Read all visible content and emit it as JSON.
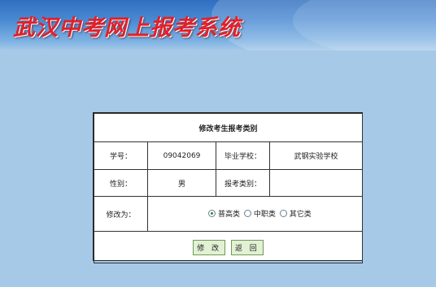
{
  "header": {
    "title": "武汉中考网上报考系统"
  },
  "form": {
    "title": "修改考生报考类别",
    "student_id_label": "学号：",
    "student_id_value": "09042069",
    "school_label": "毕业学校：",
    "school_value": "武钢实验学校",
    "gender_label": "性别：",
    "gender_value": "男",
    "category_label": "报考类别：",
    "category_value": "",
    "change_label": "修改为：",
    "options": [
      "普高类",
      "中职类",
      "其它类"
    ],
    "selected_option": "普高类",
    "submit_label": "修 改",
    "back_label": "返 回"
  }
}
